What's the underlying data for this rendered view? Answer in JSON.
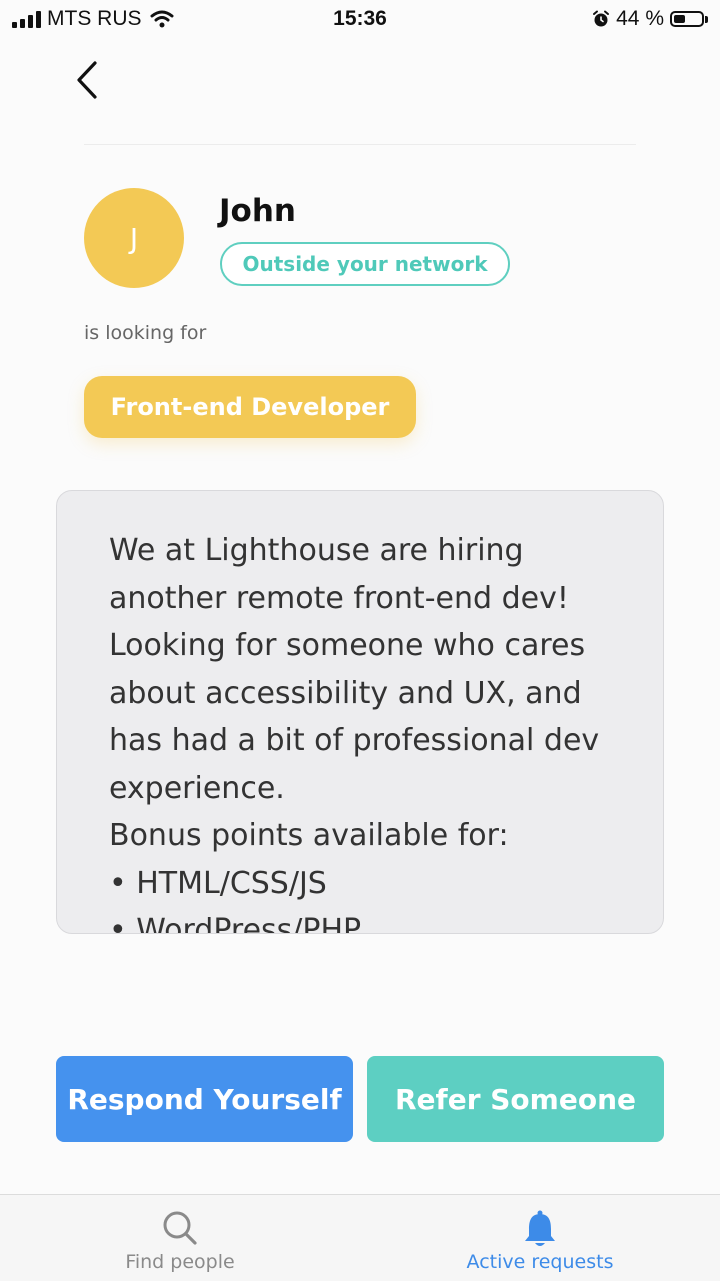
{
  "status_bar": {
    "carrier": "MTS RUS",
    "time": "15:36",
    "battery": "44 %",
    "battery_level": 0.44
  },
  "requester": {
    "avatar_initial": "J",
    "name": "John",
    "network_status": "Outside your network"
  },
  "looking_for_label": "is looking for",
  "role": "Front-end Developer",
  "message": {
    "lines": [
      "We at Lighthouse are hiring",
      "another remote front-end dev!",
      "Looking for someone who cares",
      "about accessibility and UX, and",
      "has had a bit of professional dev",
      "experience.",
      "Bonus points available for:",
      "• HTML/CSS/JS",
      "• WordPress/PHP"
    ]
  },
  "actions": {
    "respond_label": "Respond Yourself",
    "refer_label": "Refer Someone"
  },
  "tabs": [
    {
      "label": "Find people",
      "icon": "search-icon",
      "active": false
    },
    {
      "label": "Active requests",
      "icon": "bell-icon",
      "active": true
    }
  ],
  "colors": {
    "accent_yellow": "#f3c955",
    "teal": "#5dcfc2",
    "blue": "#4592ee",
    "tab_active": "#3d8be8"
  }
}
